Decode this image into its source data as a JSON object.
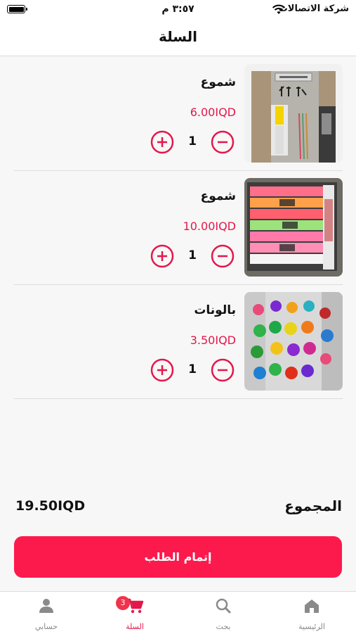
{
  "status_bar": {
    "carrier": "شركة الاتصالات",
    "time": "٣:٥٧ م"
  },
  "header": {
    "title": "السلة"
  },
  "cart": {
    "items": [
      {
        "name": "شموع",
        "price": "6.00IQD",
        "quantity": "1",
        "image": "candle-package-photo"
      },
      {
        "name": "شموع",
        "price": "10.00IQD",
        "quantity": "1",
        "image": "colored-candles-photo"
      },
      {
        "name": "بالونات",
        "price": "3.50IQD",
        "quantity": "1",
        "image": "tinsel-garland-photo"
      }
    ]
  },
  "totals": {
    "label": "المجموع",
    "value": "19.50IQD"
  },
  "checkout": {
    "label": "إتمام الطلب"
  },
  "tab_bar": {
    "tabs": [
      {
        "label": "الرئيسية",
        "icon": "home-icon"
      },
      {
        "label": "بحث",
        "icon": "search-icon"
      },
      {
        "label": "السلة",
        "icon": "cart-icon",
        "badge": "3",
        "active": true
      },
      {
        "label": "حسابي",
        "icon": "user-icon"
      }
    ]
  },
  "colors": {
    "accent": "#fc1a4d",
    "price": "#e4174b",
    "inactive": "#888888"
  }
}
